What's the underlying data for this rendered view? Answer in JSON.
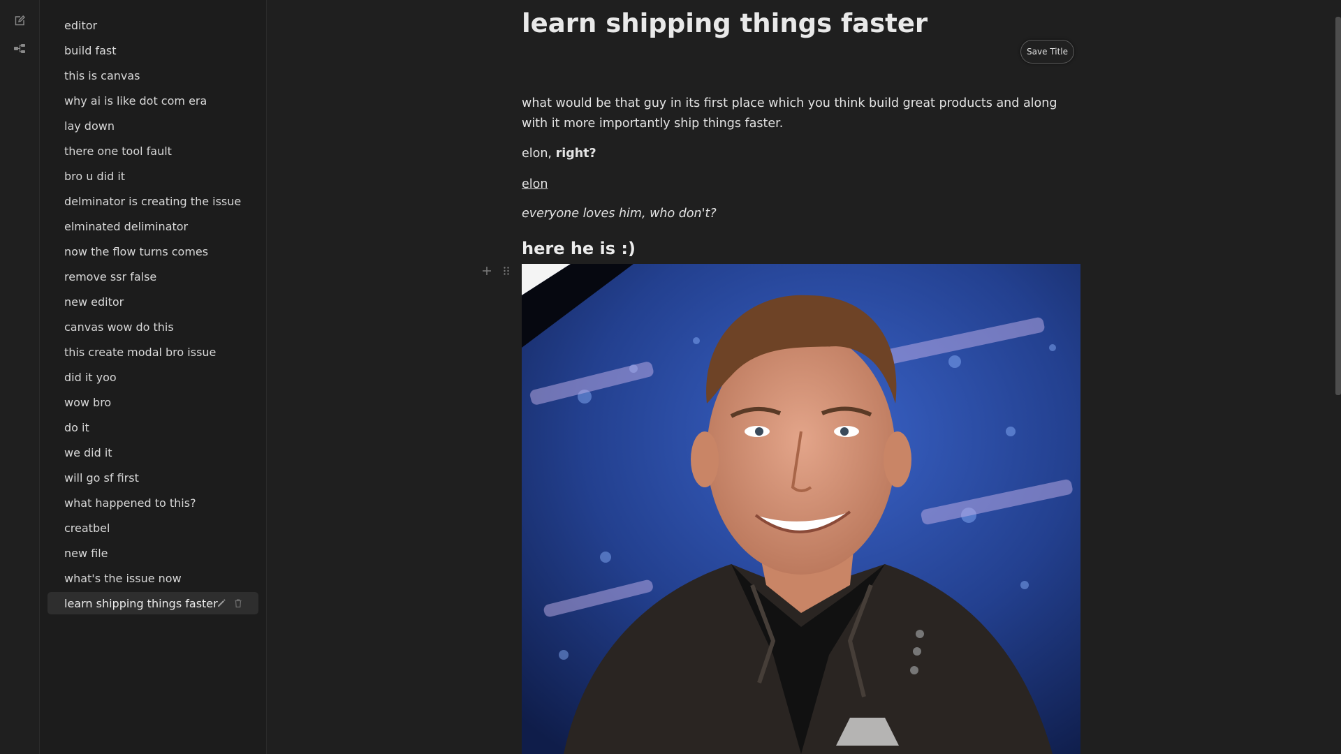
{
  "rail": {
    "icons": [
      "new-file-icon",
      "file-tree-icon"
    ]
  },
  "sidebar": {
    "files": [
      {
        "label": "editor"
      },
      {
        "label": "build fast"
      },
      {
        "label": "this is canvas"
      },
      {
        "label": "why ai is like dot com era"
      },
      {
        "label": "lay down"
      },
      {
        "label": "there one tool fault"
      },
      {
        "label": "bro u did it"
      },
      {
        "label": "delminator is creating the issue"
      },
      {
        "label": "elminated deliminator"
      },
      {
        "label": "now the flow turns comes"
      },
      {
        "label": "remove ssr false"
      },
      {
        "label": "new editor"
      },
      {
        "label": "canvas wow do this"
      },
      {
        "label": "this create modal bro issue"
      },
      {
        "label": "did it yoo"
      },
      {
        "label": "wow bro"
      },
      {
        "label": "do it"
      },
      {
        "label": "we did it"
      },
      {
        "label": "will go sf first"
      },
      {
        "label": "what happened to this?"
      },
      {
        "label": "creatbel"
      },
      {
        "label": "new file"
      },
      {
        "label": "what's the issue now"
      },
      {
        "label": "learn shipping things faster",
        "active": true
      }
    ],
    "active_actions": [
      "edit-pencil-icon",
      "trash-icon"
    ]
  },
  "doc": {
    "title": "learn shipping things faster",
    "save_title_label": "Save Title",
    "paragraph1": "what would be that guy in its first place which you think build great products and along with it more importantly ship things faster.",
    "paragraph2_plain": "elon, ",
    "paragraph2_bold": "right?",
    "paragraph3_link": "elon",
    "paragraph4_italic": "everyone loves him, who don't?",
    "heading": "here he is :)",
    "image_subject": "photo of a smiling man in a leather jacket against a blue starry backdrop"
  },
  "colors": {
    "background": "#1f1f1f",
    "sidebar_bg": "#1c1c1c",
    "active_item_bg": "#2e2e2e",
    "text": "#e4e4e4",
    "photo_backdrop": "#2a4aa8"
  }
}
